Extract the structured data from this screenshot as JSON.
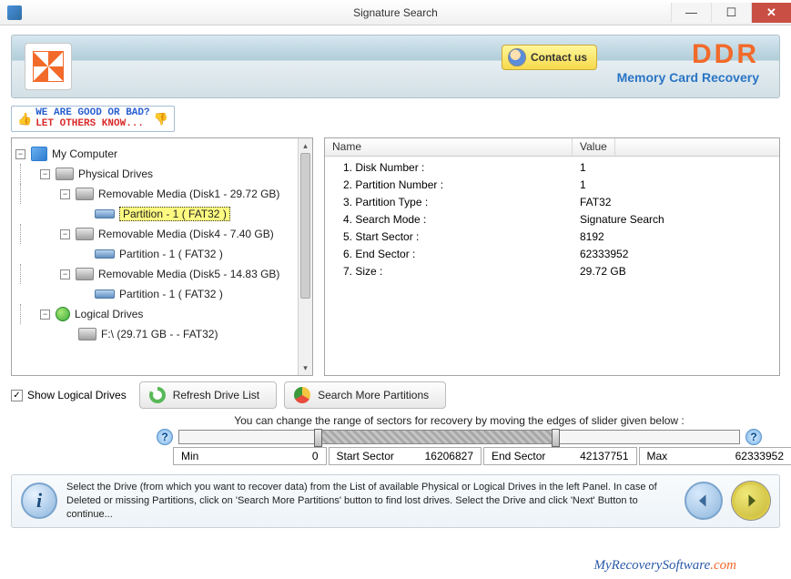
{
  "window": {
    "title": "Signature Search"
  },
  "banner": {
    "contact_label": "Contact us",
    "brand": "DDR",
    "brand_sub": "Memory Card Recovery"
  },
  "feedback": {
    "line1": "WE ARE GOOD OR BAD?",
    "line2": "LET OTHERS KNOW..."
  },
  "tree": {
    "root": "My Computer",
    "physical_label": "Physical Drives",
    "logical_label": "Logical Drives",
    "disk1": "Removable Media (Disk1 - 29.72 GB)",
    "disk1_part": "Partition - 1 ( FAT32 )",
    "disk4": "Removable Media (Disk4 - 7.40 GB)",
    "disk4_part": "Partition - 1 ( FAT32 )",
    "disk5": "Removable Media (Disk5 - 14.83 GB)",
    "disk5_part": "Partition - 1 ( FAT32 )",
    "f_drive": "F:\\ (29.71 GB -  - FAT32)"
  },
  "info": {
    "col_name": "Name",
    "col_value": "Value",
    "rows": [
      {
        "n": "1. Disk Number :",
        "v": "1"
      },
      {
        "n": "2. Partition Number :",
        "v": "1"
      },
      {
        "n": "3. Partition Type :",
        "v": "FAT32"
      },
      {
        "n": "4. Search Mode :",
        "v": "Signature Search"
      },
      {
        "n": "5. Start Sector :",
        "v": "8192"
      },
      {
        "n": "6. End Sector :",
        "v": "62333952"
      },
      {
        "n": "7. Size :",
        "v": "29.72 GB"
      }
    ]
  },
  "controls": {
    "show_logical": "Show Logical Drives",
    "refresh": "Refresh Drive List",
    "search_more": "Search More Partitions"
  },
  "slider": {
    "hint": "You can change the range of sectors for recovery by moving the edges of slider given below :",
    "min_label": "Min",
    "min_val": "0",
    "start_label": "Start Sector",
    "start_val": "16206827",
    "end_label": "End Sector",
    "end_val": "42137751",
    "max_label": "Max",
    "max_val": "62333952"
  },
  "instruction": "Select the Drive (from which you want to recover data) from the List of available Physical or Logical Drives in the left Panel. In case of Deleted or missing Partitions, click on 'Search More Partitions' button to find lost drives. Select the Drive and click 'Next' Button to continue...",
  "footer": {
    "site_a": "MyRecoverySoftware",
    "site_b": ".com"
  }
}
